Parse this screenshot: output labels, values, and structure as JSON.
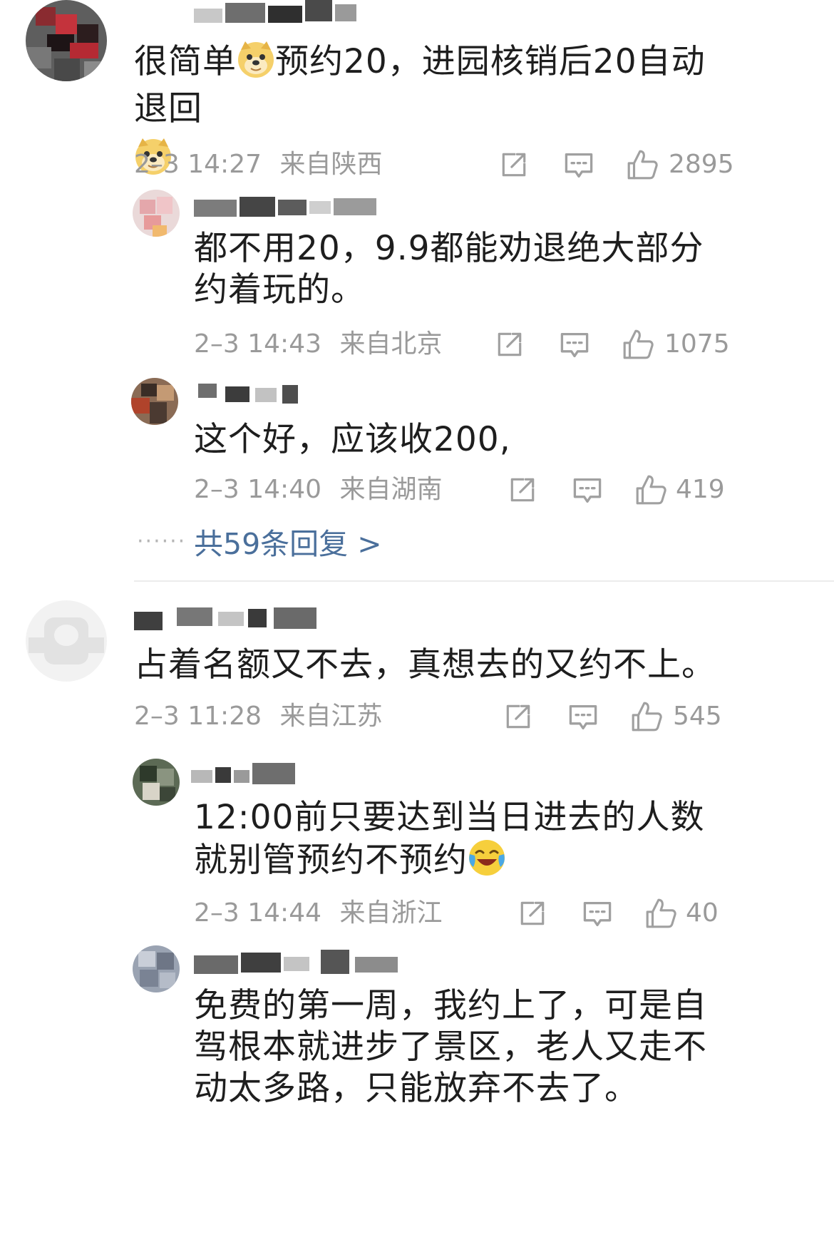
{
  "colors": {
    "text": "#1e1e1e",
    "meta": "#9a9a9a",
    "link": "#4a6f9b",
    "divider": "#ececec"
  },
  "icons": {
    "forward": "share-square-icon",
    "comment": "comment-bubble-icon",
    "like": "thumbs-up-icon",
    "emoji_doge": "doge-emoji-icon",
    "emoji_laugh_cry": "laugh-cry-emoji-icon"
  },
  "comments": [
    {
      "text_a": "很简单",
      "text_b": "预约20，进园核销后20自动退回",
      "time": "2–3 14:27",
      "location": "来自陕西",
      "likes": "2895",
      "replies": [
        {
          "text": "都不用20，9.9都能劝退绝大部分约着玩的。",
          "time": "2–3 14:43",
          "location": "来自北京",
          "likes": "1075"
        },
        {
          "text": "这个好，应该收200,",
          "time": "2–3 14:40",
          "location": "来自湖南",
          "likes": "419"
        }
      ],
      "more_replies": "共59条回复 >"
    },
    {
      "text": "占着名额又不去，真想去的又约不上。",
      "time": "2–3 11:28",
      "location": "来自江苏",
      "likes": "545",
      "replies": [
        {
          "text_a": "12:00前只要达到当日进去的人数 就别管预约不预约",
          "time": "2–3 14:44",
          "location": "来自浙江",
          "likes": "40"
        },
        {
          "text": "免费的第一周，我约上了，可是自驾根本就进步了景区，老人又走不动太多路，只能放弃不去了。"
        }
      ]
    }
  ]
}
